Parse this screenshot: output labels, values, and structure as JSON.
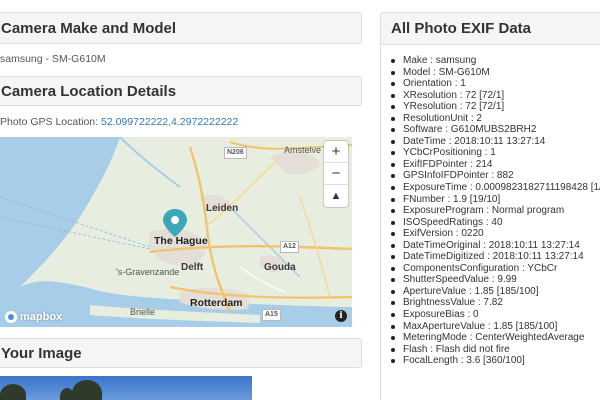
{
  "make_panel": {
    "heading": "Camera Make and Model",
    "value": "samsung - SM-G610M"
  },
  "location_panel": {
    "heading": "Camera Location Details",
    "gps_label": "Photo GPS Location: ",
    "gps_value": "52.099722222,4.2972222222"
  },
  "map": {
    "places": {
      "amstelveen": "Amstelve",
      "n206": "N206",
      "leiden": "Leiden",
      "the_hague": "The Hague",
      "a12": "A12",
      "delft": "Delft",
      "gouda": "Gouda",
      "gravenzande": "'s-Gravenzande",
      "rotterdam": "Rotterdam",
      "brielle": "Brielle",
      "a15": "A15"
    },
    "zoom_in": "+",
    "zoom_out": "−",
    "compass": "▲",
    "logo_text": "mapbox",
    "info": "i",
    "colors": {
      "water": "#a8cde8",
      "land": "#e7eddf",
      "urban": "#e3dfd6",
      "road": "#f3c26b",
      "pin": "#3ba7b8"
    }
  },
  "image_panel": {
    "heading": "Your Image"
  },
  "exif_panel": {
    "heading": "All Photo EXIF Data",
    "items": [
      "Make : samsung",
      "Model : SM-G610M",
      "Orientation : 1",
      "XResolution : 72 [72/1]",
      "YResolution : 72 [72/1]",
      "ResolutionUnit : 2",
      "Software : G610MUBS2BRH2",
      "DateTime : 2018:10:11 13:27:14",
      "YCbCrPositioning : 1",
      "ExifIFDPointer : 214",
      "GPSInfoIFDPointer : 882",
      "ExposureTime : 0.0009823182711198428 [1/10",
      "FNumber : 1.9 [19/10]",
      "ExposureProgram : Normal program",
      "ISOSpeedRatings : 40",
      "ExifVersion : 0220",
      "DateTimeOriginal : 2018:10:11 13:27:14",
      "DateTimeDigitized : 2018:10:11 13:27:14",
      "ComponentsConfiguration : YCbCr",
      "ShutterSpeedValue : 9.99",
      "ApertureValue : 1.85 [185/100]",
      "BrightnessValue : 7.82",
      "ExposureBias : 0",
      "MaxApertureValue : 1.85 [185/100]",
      "MeteringMode : CenterWeightedAverage",
      "Flash : Flash did not fire",
      "FocalLength : 3.6 [360/100]"
    ]
  }
}
